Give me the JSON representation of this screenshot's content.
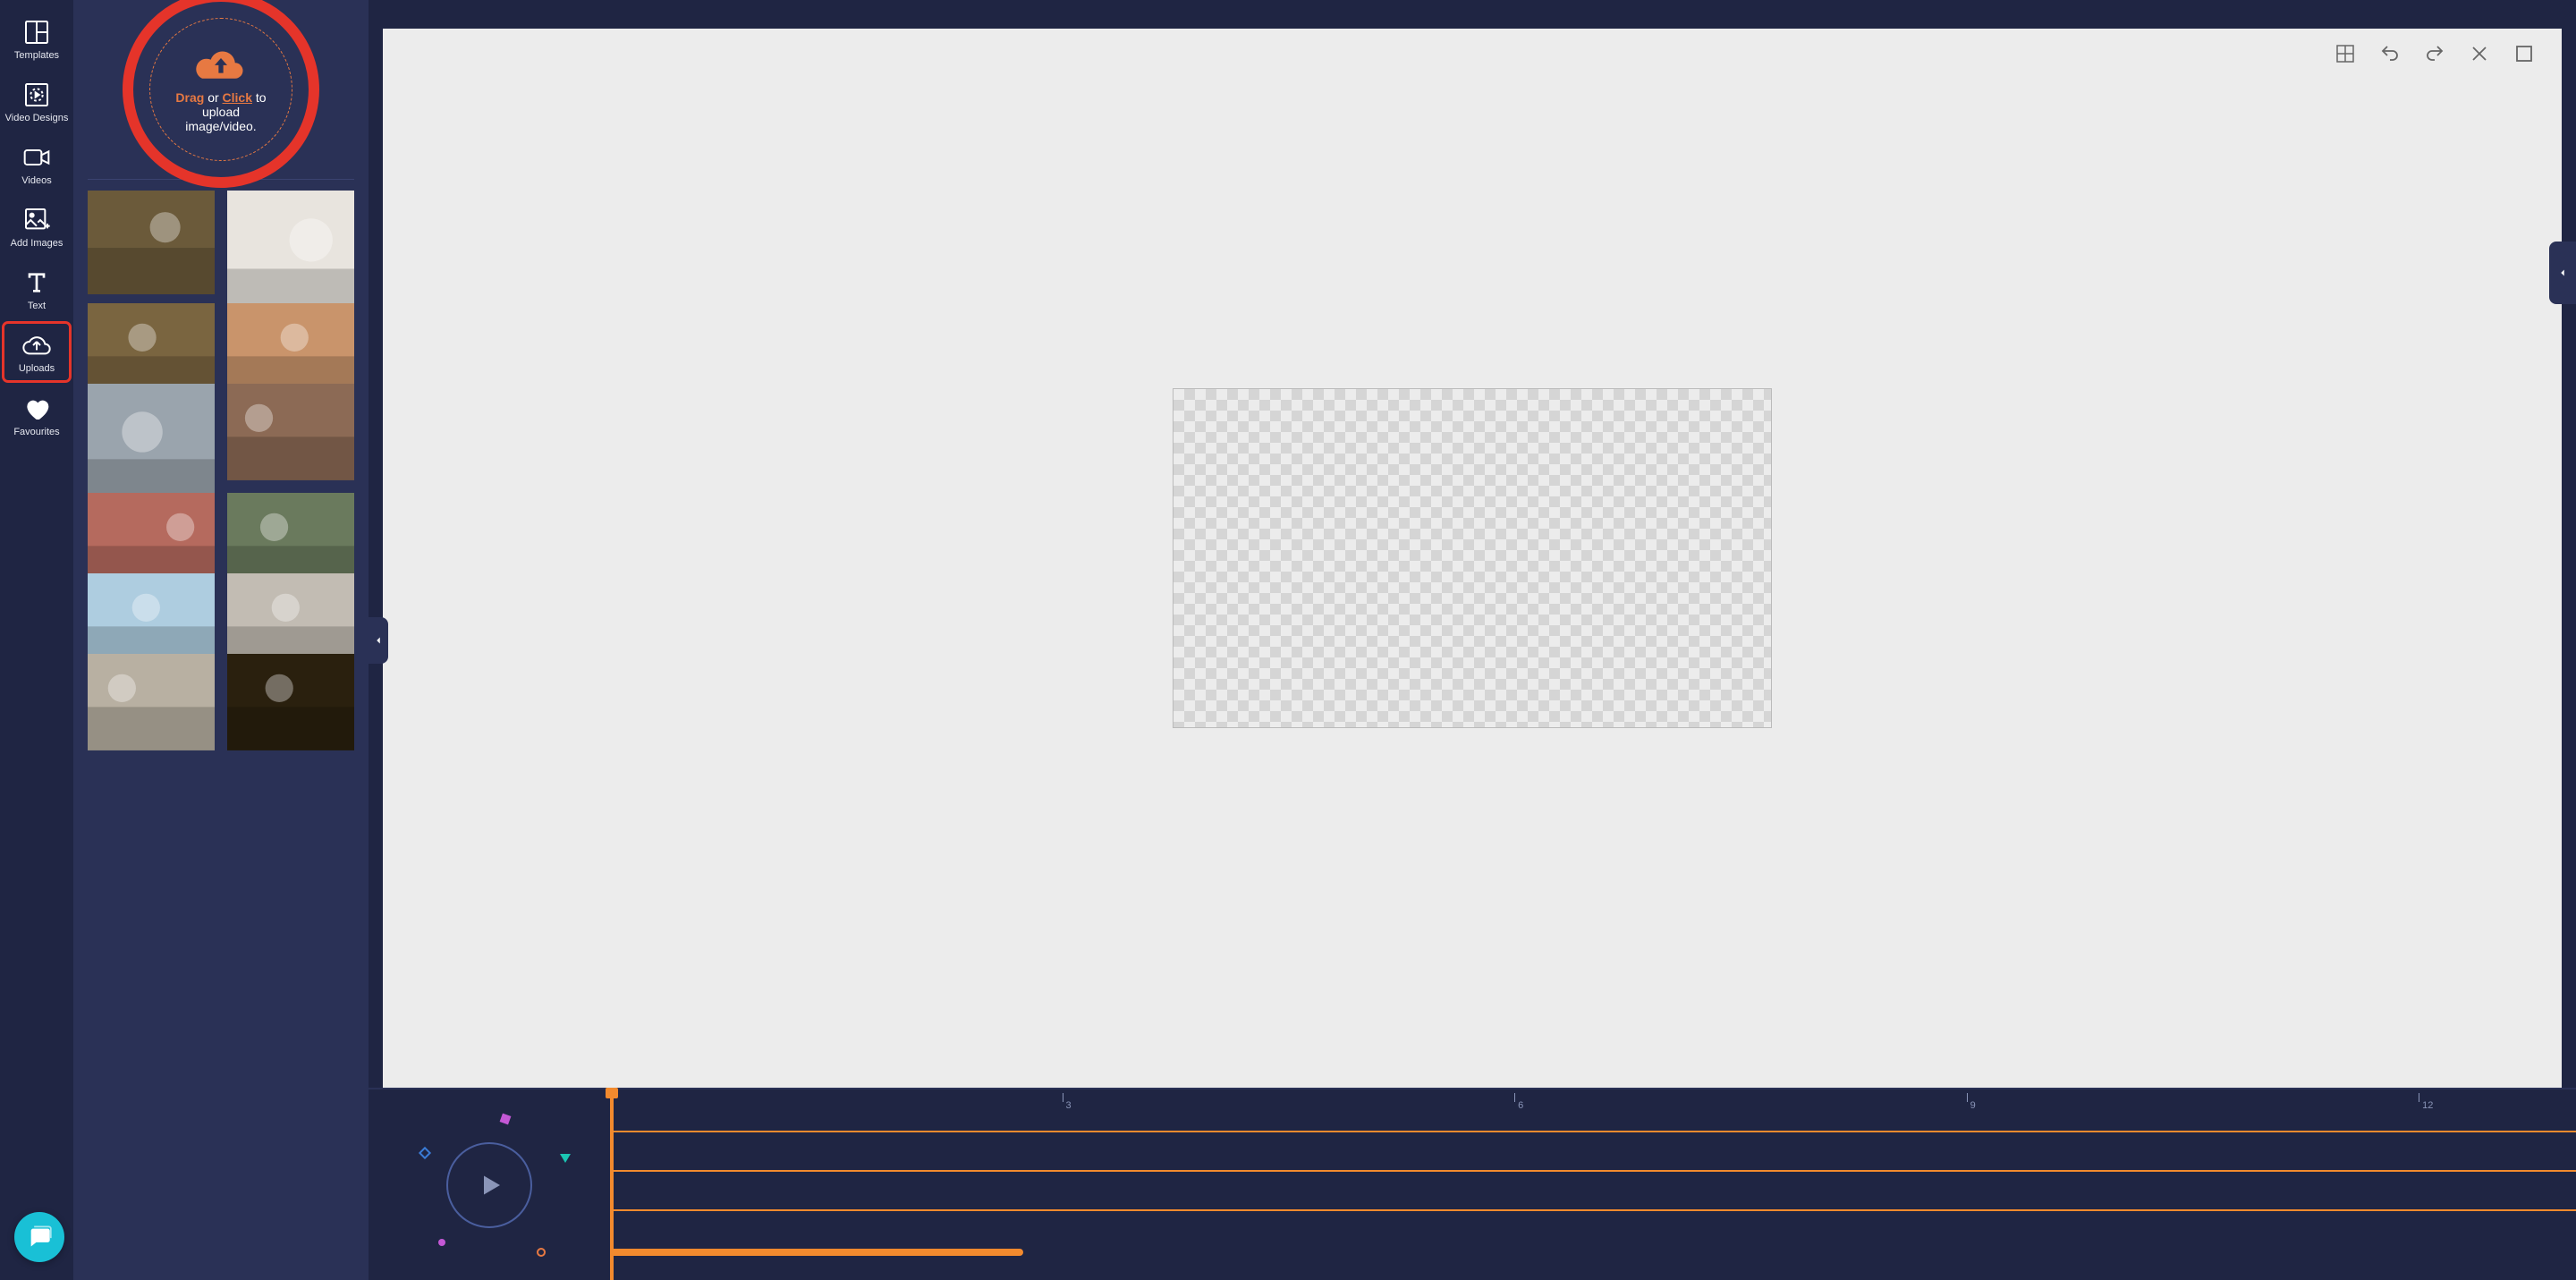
{
  "rail": {
    "items": [
      {
        "id": "templates",
        "label": "Templates"
      },
      {
        "id": "video-designs",
        "label": "Video Designs"
      },
      {
        "id": "videos",
        "label": "Videos"
      },
      {
        "id": "add-images",
        "label": "Add Images"
      },
      {
        "id": "text",
        "label": "Text"
      },
      {
        "id": "uploads",
        "label": "Uploads"
      },
      {
        "id": "favourites",
        "label": "Favourites"
      }
    ],
    "active": "uploads"
  },
  "upload_zone": {
    "drag": "Drag",
    "or": " or ",
    "click": "Click",
    "to": " to",
    "line2": "upload",
    "line3": "image/video."
  },
  "thumbnails": [
    {
      "id": "coffee-flatlay",
      "bg": "#6b5a3a",
      "h": 82
    },
    {
      "id": "window-wreath",
      "bg": "#e8e4de",
      "h": 112
    },
    {
      "id": "cooking-hands",
      "bg": "#7a6540",
      "h": 76
    },
    {
      "id": "woman-sunset",
      "bg": "#c9946b",
      "h": 76
    },
    {
      "id": "skyscraper",
      "bg": "#9aa4ad",
      "h": 108
    },
    {
      "id": "couple-hug",
      "bg": "#8c6a55",
      "h": 76
    },
    {
      "id": "white-flower",
      "bg": "#b56a5e",
      "h": 76
    },
    {
      "id": "smiling-couple",
      "bg": "#6a7a5d",
      "h": 76
    },
    {
      "id": "hot-air-balloon",
      "bg": "#aecde0",
      "h": 76
    },
    {
      "id": "fist-bump",
      "bg": "#c2bcb3",
      "h": 76
    },
    {
      "id": "sofa-laptop",
      "bg": "#b8b0a2",
      "h": 76
    },
    {
      "id": "sparkler",
      "bg": "#2a200e",
      "h": 76
    }
  ],
  "canvas_tools": [
    {
      "id": "grid",
      "name": "grid-icon"
    },
    {
      "id": "undo",
      "name": "undo-icon"
    },
    {
      "id": "redo",
      "name": "redo-icon"
    },
    {
      "id": "close",
      "name": "close-icon"
    },
    {
      "id": "fullscreen",
      "name": "fullscreen-icon"
    }
  ],
  "timeline": {
    "ticks": [
      {
        "n": "3",
        "pct": 23
      },
      {
        "n": "6",
        "pct": 46
      },
      {
        "n": "9",
        "pct": 69
      },
      {
        "n": "12",
        "pct": 92
      }
    ],
    "clips": [
      {
        "row": 0,
        "left": 0,
        "width": 100,
        "thick": false
      },
      {
        "row": 1,
        "left": 0,
        "width": 100,
        "thick": false
      },
      {
        "row": 2,
        "left": 0,
        "width": 100,
        "thick": false
      },
      {
        "row": 3,
        "left": 0,
        "width": 21,
        "thick": true
      }
    ]
  }
}
